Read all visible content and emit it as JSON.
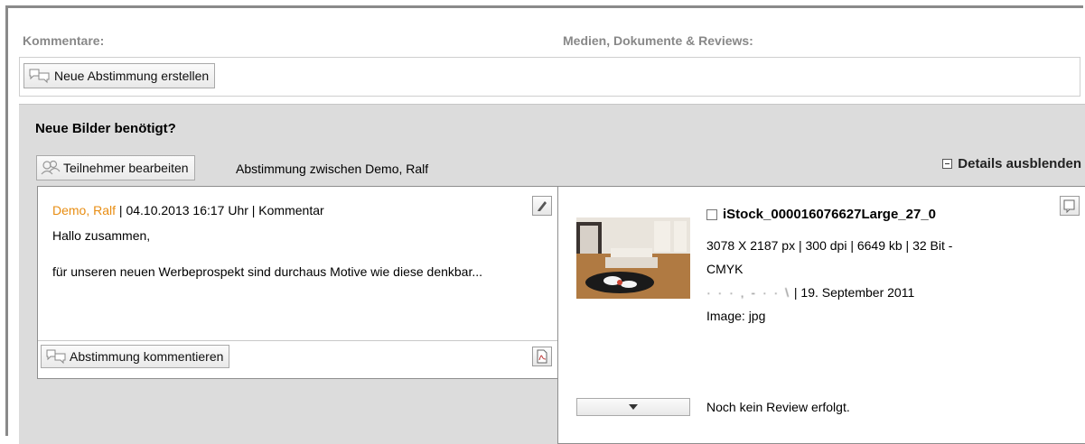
{
  "header": {
    "comments_label": "Kommentare:",
    "media_label": "Medien, Dokumente & Reviews:"
  },
  "toolbar": {
    "new_vote_label": "Neue Abstimmung erstellen"
  },
  "vote": {
    "title": "Neue Bilder benötigt?",
    "edit_participants_label": "Teilnehmer bearbeiten",
    "between_text": "Abstimmung zwischen  Demo, Ralf",
    "details_toggle_label": "Details ausblenden"
  },
  "comment": {
    "author": "Demo, Ralf",
    "meta": " | 04.10.2013 16:17 Uhr | Kommentar",
    "line1": "Hallo zusammen,",
    "line2": "für unseren neuen Werbeprospekt sind durchaus Motive wie diese denkbar...",
    "comment_vote_label": "Abstimmung kommentieren",
    "author_color": "#e88d12"
  },
  "media": {
    "filename": "iStock_000016076627Large_27_0",
    "info_line1": "3078 X 2187 px | 300 dpi | 6649 kb | 32 Bit - CMYK",
    "blurred_text": "· · ·  , -  ·  ·  \\",
    "date": "| 19. September 2011",
    "type": "Image: jpg",
    "review_status": "Noch kein Review erfolgt."
  },
  "icons": {
    "new_vote": "vote-speech-icon",
    "participants": "people-icon",
    "edit": "pencil-icon",
    "pdf": "pdf-icon",
    "media_action": "document-icon",
    "dropdown": "caret-down-icon"
  }
}
